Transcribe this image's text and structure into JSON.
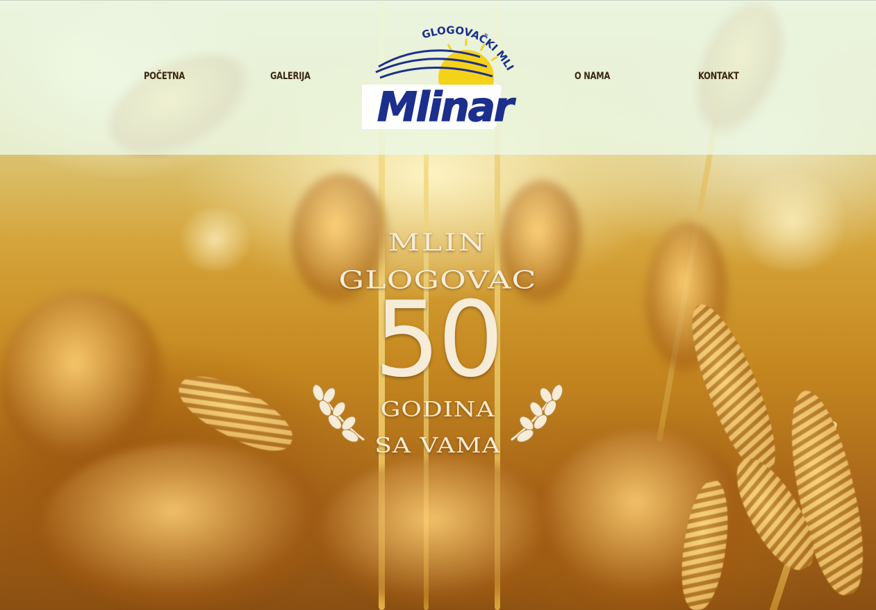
{
  "nav": {
    "items": [
      {
        "label": "POČETNA"
      },
      {
        "label": "GALERIJA"
      },
      {
        "label": "O NAMA"
      },
      {
        "label": "KONTAKT"
      }
    ]
  },
  "logo": {
    "arc_text": "GLOGOVAČKI MLIN",
    "brand": "Mlinar"
  },
  "hero": {
    "line1": "MLIN",
    "line2": "GLOGOVAC",
    "number": "50",
    "line3": "GODINA",
    "line4": "SA VAMA"
  },
  "colors": {
    "header_bg": "#ebf8e8",
    "nav_text": "#3a2810",
    "logo_blue": "#1c2f8c",
    "logo_sun": "#f5d21a",
    "badge_text": "#f6ecd8"
  }
}
